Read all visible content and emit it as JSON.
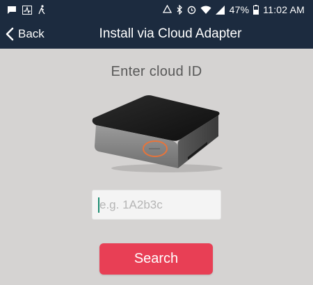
{
  "status_bar": {
    "battery": "47%",
    "time": "11:02 AM",
    "left_icons": [
      "chat-icon",
      "pulse-icon",
      "walk-icon"
    ],
    "right_icons": [
      "recycle-icon",
      "bluetooth-icon",
      "alarm-icon",
      "wifi-icon",
      "signal-icon",
      "battery-icon"
    ]
  },
  "nav": {
    "back_label": "Back",
    "title": "Install via Cloud Adapter"
  },
  "main": {
    "prompt": "Enter cloud ID",
    "input_placeholder": "e.g. 1A2b3c",
    "input_value": "",
    "search_label": "Search"
  },
  "colors": {
    "header_bg": "#1c2b3f",
    "page_bg": "#d5d3d2",
    "button": "#e83f55",
    "highlight_ring": "#e8743a"
  }
}
